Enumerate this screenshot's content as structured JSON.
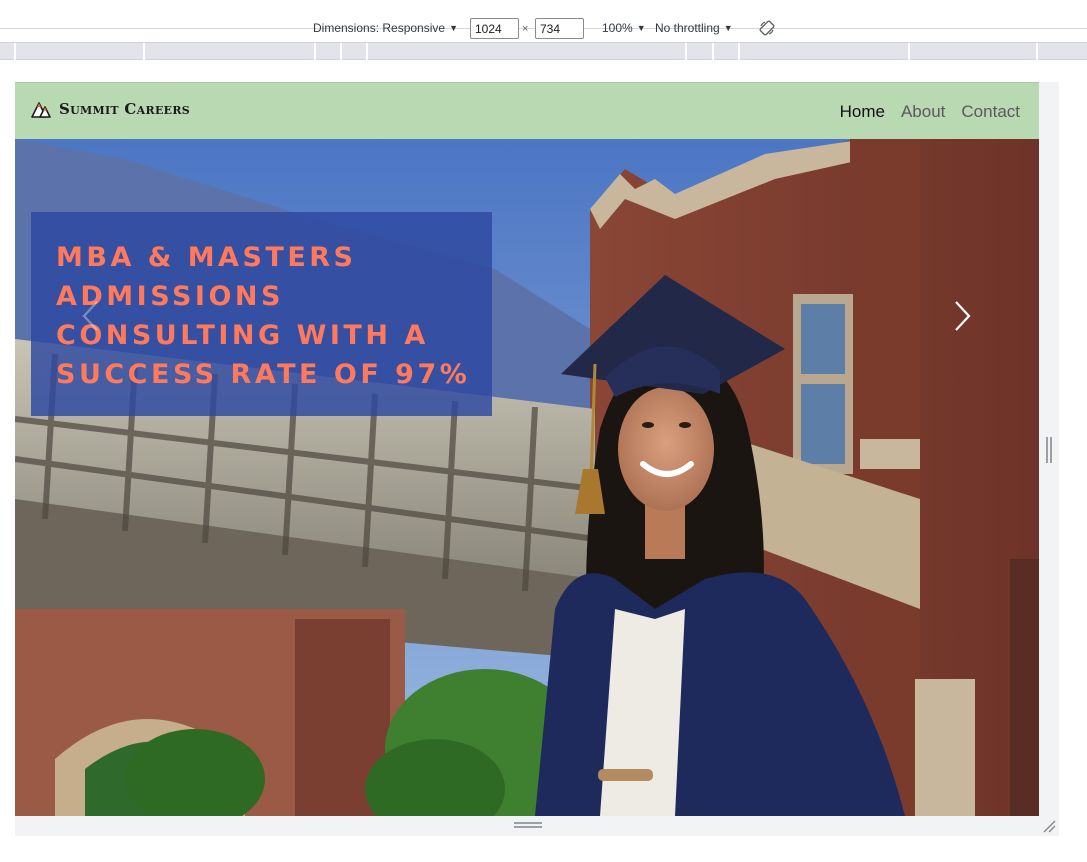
{
  "devtools": {
    "dimensions_label": "Dimensions: Responsive",
    "width_value": "1024",
    "height_value": "734",
    "times_sign": "×",
    "zoom_label": "100%",
    "throttling_label": "No throttling",
    "caret": "▼"
  },
  "site": {
    "brand": "Summit Careers",
    "nav": [
      {
        "label": "Home",
        "active": true
      },
      {
        "label": "About",
        "active": false
      },
      {
        "label": "Contact",
        "active": false
      }
    ],
    "hero": {
      "headline": "MBA & Masters Admissions Consulting with a Success Rate of 97%"
    }
  },
  "colors": {
    "navbar": "#b8d9b2",
    "headline_box": "#2d48a0",
    "headline_text": "#ff7a5c",
    "gown": "#1f2a5c"
  },
  "icons": {
    "brand": "mountain-logo-icon",
    "prev": "chevron-left-icon",
    "next": "chevron-right-icon",
    "rotate": "rotate-icon"
  }
}
